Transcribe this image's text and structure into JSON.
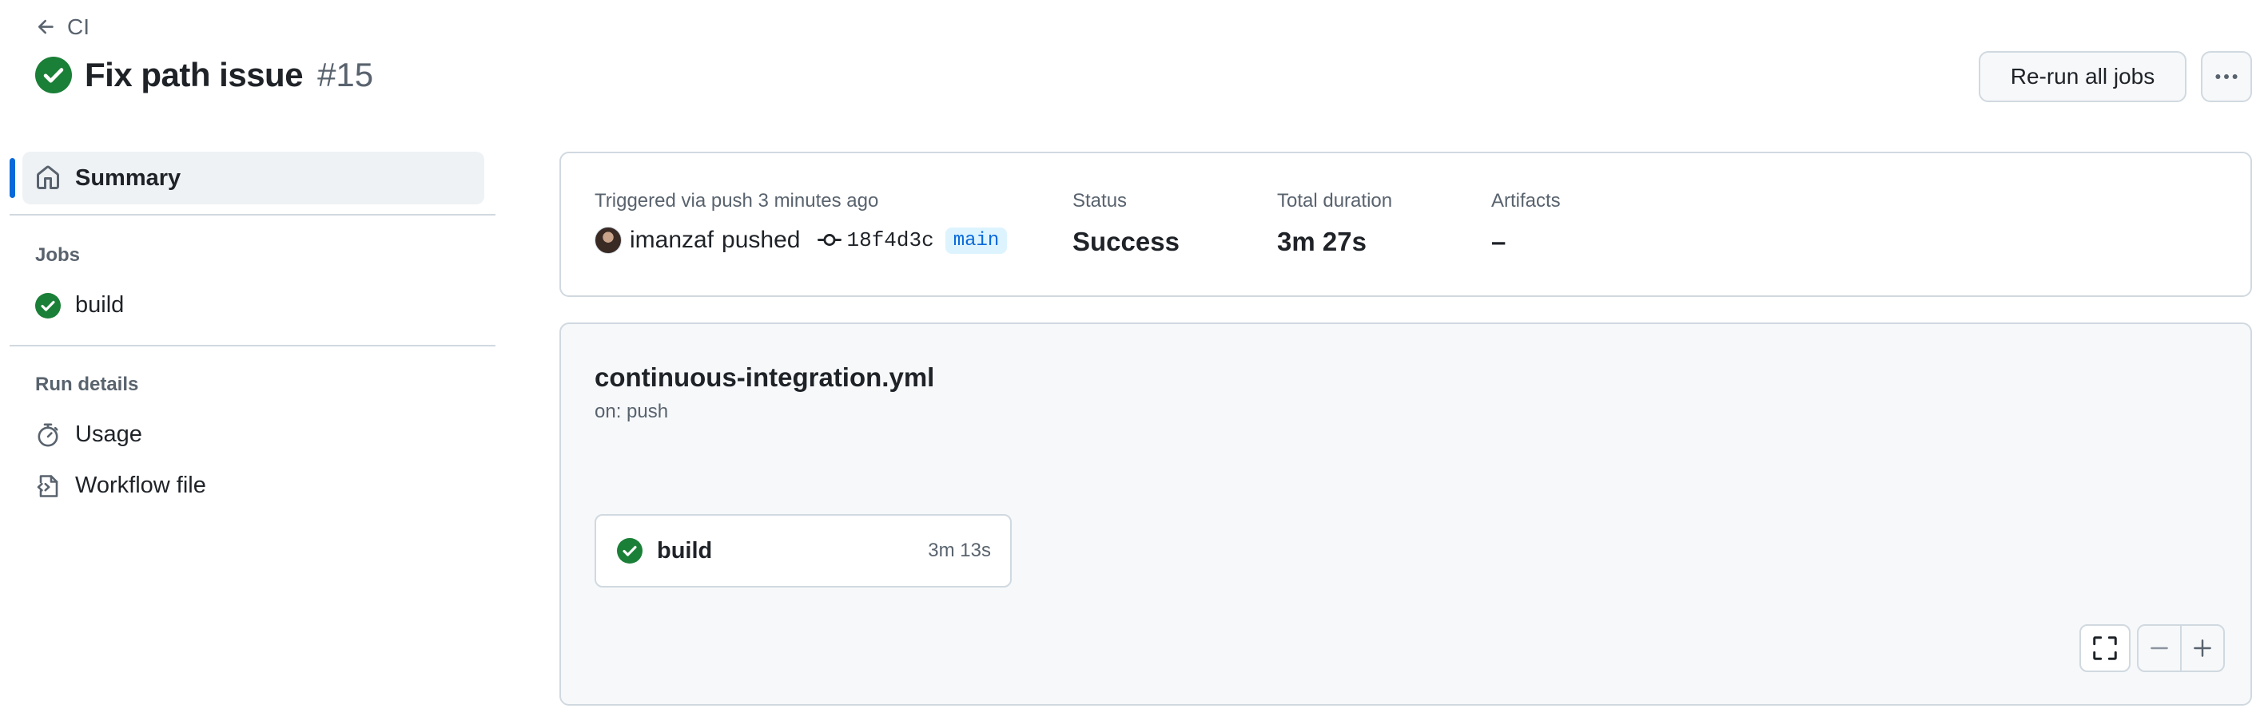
{
  "header": {
    "back_label": "CI",
    "title": "Fix path issue",
    "run_number": "#15",
    "rerun_label": "Re-run all jobs"
  },
  "sidebar": {
    "summary_label": "Summary",
    "jobs_section": "Jobs",
    "jobs": [
      {
        "label": "build",
        "status": "success"
      }
    ],
    "run_details_section": "Run details",
    "usage_label": "Usage",
    "workflow_file_label": "Workflow file"
  },
  "summary": {
    "trigger_label": "Triggered via push 3 minutes ago",
    "actor": "imanzaf",
    "action": "pushed",
    "commit": "18f4d3c",
    "branch": "main",
    "status_label": "Status",
    "status_value": "Success",
    "duration_label": "Total duration",
    "duration_value": "3m 27s",
    "artifacts_label": "Artifacts",
    "artifacts_value": "–"
  },
  "workflow": {
    "name": "continuous-integration.yml",
    "trigger": "on: push",
    "job_name": "build",
    "job_duration": "3m 13s"
  },
  "icons": {
    "back": "arrow-left-icon",
    "status": "check-circle-fill-icon",
    "summary": "home-icon",
    "usage": "stopwatch-icon",
    "workflow_file": "file-code-icon",
    "commit": "git-commit-icon",
    "more": "kebab-horizontal-icon",
    "fit": "screen-full-icon",
    "zoom_out": "dash-icon",
    "zoom_in": "plus-icon"
  },
  "colors": {
    "success": "#1a7f37",
    "accent": "#0969da",
    "border": "#d1d9e0",
    "muted_text": "#59636e"
  }
}
